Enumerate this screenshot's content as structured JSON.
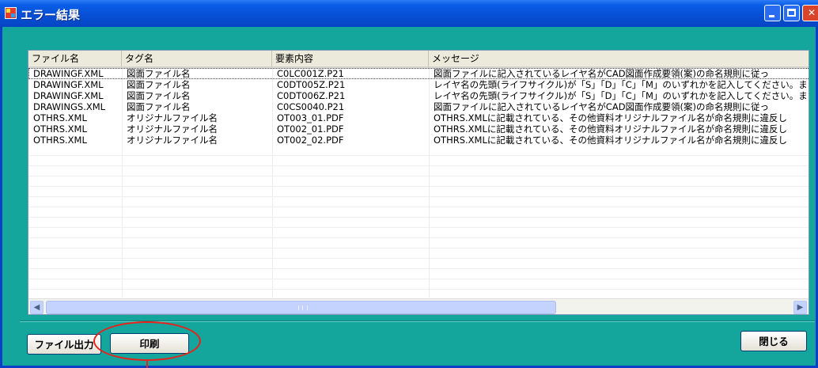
{
  "window": {
    "title": "エラー結果"
  },
  "table": {
    "columns": [
      "ファイル名",
      "タグ名",
      "要素内容",
      "メッセージ"
    ],
    "rows": [
      [
        "DRAWINGF.XML",
        "図面ファイル名",
        "C0LC001Z.P21",
        "図面ファイルに記入されているレイヤ名がCAD図面作成要領(案)の命名規則に従っ"
      ],
      [
        "DRAWINGF.XML",
        "図面ファイル名",
        "C0DT005Z.P21",
        "レイヤ名の先頭(ライフサイクル)が「S」「D」「C」「M」のいずれかを記入してください。また"
      ],
      [
        "DRAWINGF.XML",
        "図面ファイル名",
        "C0DT006Z.P21",
        "レイヤ名の先頭(ライフサイクル)が「S」「D」「C」「M」のいずれかを記入してください。また"
      ],
      [
        "DRAWINGS.XML",
        "図面ファイル名",
        "C0CS0040.P21",
        "図面ファイルに記入されているレイヤ名がCAD図面作成要領(案)の命名規則に従っ"
      ],
      [
        "OTHRS.XML",
        "オリジナルファイル名",
        "OT003_01.PDF",
        "OTHRS.XMLに記載されている、その他資料オリジナルファイル名が命名規則に違反し"
      ],
      [
        "OTHRS.XML",
        "オリジナルファイル名",
        "OT002_01.PDF",
        "OTHRS.XMLに記載されている、その他資料オリジナルファイル名が命名規則に違反し"
      ],
      [
        "OTHRS.XML",
        "オリジナルファイル名",
        "OT002_02.PDF",
        "OTHRS.XMLに記載されている、その他資料オリジナルファイル名が命名規則に違反し"
      ]
    ]
  },
  "buttons": {
    "export": "ファイル出力",
    "print": "印刷",
    "close": "閉じる"
  },
  "colors": {
    "window_bg": "#14a59c",
    "titlebar": "#0650d6",
    "highlight": "#e8221a"
  },
  "icons": {
    "app": "app-icon",
    "minimize": "minimize-icon",
    "maximize": "maximize-icon",
    "close": "close-icon",
    "scroll_left": "chevron-left-icon",
    "scroll_right": "chevron-right-icon"
  }
}
